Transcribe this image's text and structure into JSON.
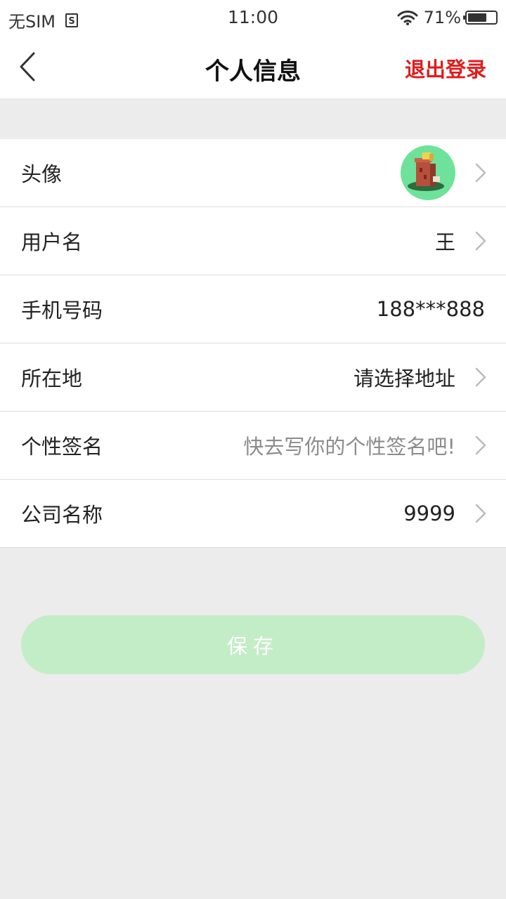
{
  "status_bar": {
    "carrier": "无SIM",
    "sim_badge": "S",
    "time": "11:00",
    "battery_percent": "71%",
    "battery_level": 0.71
  },
  "nav": {
    "title": "个人信息",
    "logout_label": "退出登录"
  },
  "profile": {
    "avatar_label": "头像",
    "username_label": "用户名",
    "username_value": "王",
    "phone_label": "手机号码",
    "phone_value": "188***888",
    "location_label": "所在地",
    "location_value": "请选择地址",
    "signature_label": "个性签名",
    "signature_placeholder": "快去写你的个性签名吧!",
    "company_label": "公司名称",
    "company_value": "9999"
  },
  "actions": {
    "save_label": "保存"
  },
  "colors": {
    "accent_red": "#e01c1c",
    "save_button_bg": "#c3edc6",
    "page_bg": "#ececec"
  }
}
